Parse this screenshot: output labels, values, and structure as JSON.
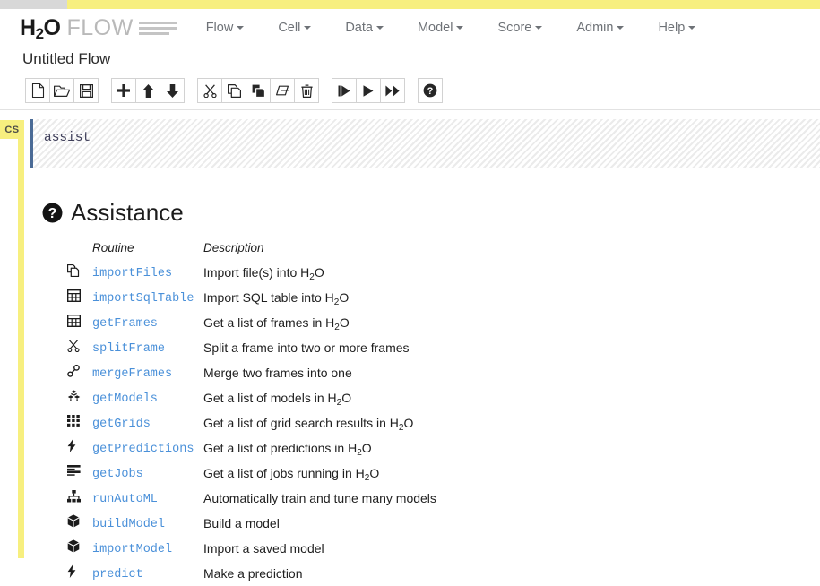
{
  "theme": {
    "accent_yellow": "#f7ef7f",
    "accent_gray": "#d8d8d8",
    "link_blue": "#4a90d9",
    "cell_bar_blue": "#4b6b96",
    "nav_text": "#6e7277"
  },
  "brand": {
    "h2o_main": "H",
    "h2o_sub": "2",
    "h2o_tail": "O",
    "product": "FLOW",
    "menu_icon": "hamburger-icon"
  },
  "nav": {
    "items": [
      {
        "label": "Flow",
        "has_caret": true
      },
      {
        "label": "Cell",
        "has_caret": true
      },
      {
        "label": "Data",
        "has_caret": true
      },
      {
        "label": "Model",
        "has_caret": true
      },
      {
        "label": "Score",
        "has_caret": true
      },
      {
        "label": "Admin",
        "has_caret": true
      },
      {
        "label": "Help",
        "has_caret": true
      }
    ]
  },
  "flow": {
    "title": "Untitled Flow"
  },
  "toolbar": {
    "groups": [
      {
        "buttons": [
          {
            "name": "new-flow-button",
            "icon": "file-icon",
            "title": "New Flow"
          },
          {
            "name": "open-flow-button",
            "icon": "folder-open-icon",
            "title": "Open Flow"
          },
          {
            "name": "save-flow-button",
            "icon": "floppy-save-icon",
            "title": "Save Flow"
          }
        ]
      },
      {
        "buttons": [
          {
            "name": "insert-cell-button",
            "icon": "plus-icon",
            "title": "Insert Cell"
          },
          {
            "name": "move-cell-up-button",
            "icon": "arrow-up-icon",
            "title": "Move Cell Up"
          },
          {
            "name": "move-cell-down-button",
            "icon": "arrow-down-icon",
            "title": "Move Cell Down"
          }
        ]
      },
      {
        "buttons": [
          {
            "name": "cut-cell-button",
            "icon": "scissors-icon",
            "title": "Cut Cell"
          },
          {
            "name": "copy-cell-button",
            "icon": "copy-icon",
            "title": "Copy Cell"
          },
          {
            "name": "paste-cell-button",
            "icon": "paste-icon",
            "title": "Paste Cell"
          },
          {
            "name": "clear-cell-button",
            "icon": "eraser-icon",
            "title": "Clear Cell"
          },
          {
            "name": "delete-cell-button",
            "icon": "trash-icon",
            "title": "Delete Cell"
          }
        ]
      },
      {
        "buttons": [
          {
            "name": "run-cell-button",
            "icon": "step-forward-icon",
            "title": "Run Cell"
          },
          {
            "name": "run-and-select-button",
            "icon": "play-icon",
            "title": "Run and Select Below"
          },
          {
            "name": "run-all-button",
            "icon": "fast-forward-icon",
            "title": "Run All Cells"
          }
        ]
      },
      {
        "buttons": [
          {
            "name": "assist-help-button",
            "icon": "question-circle-icon",
            "title": "Assist Me"
          }
        ]
      }
    ]
  },
  "cell": {
    "badge": "CS",
    "input_value": "assist",
    "input_placeholder": ""
  },
  "assistance": {
    "icon": "question-circle-icon",
    "heading": "Assistance",
    "columns": {
      "routine": "Routine",
      "description": "Description"
    },
    "rows": [
      {
        "icon": "copy-files-icon",
        "routine": "importFiles",
        "desc_pre": "Import file(s) into H",
        "desc_sub": "2",
        "desc_post": "O"
      },
      {
        "icon": "table-grid-icon",
        "routine": "importSqlTable",
        "desc_pre": "Import SQL table into H",
        "desc_sub": "2",
        "desc_post": "O"
      },
      {
        "icon": "table-grid-icon",
        "routine": "getFrames",
        "desc_pre": "Get a list of frames in H",
        "desc_sub": "2",
        "desc_post": "O"
      },
      {
        "icon": "scissors-icon",
        "routine": "splitFrame",
        "desc_pre": "Split a frame into two or more frames",
        "desc_sub": "",
        "desc_post": ""
      },
      {
        "icon": "link-chain-icon",
        "routine": "mergeFrames",
        "desc_pre": "Merge two frames into one",
        "desc_sub": "",
        "desc_post": ""
      },
      {
        "icon": "cubes-icon",
        "routine": "getModels",
        "desc_pre": "Get a list of models in H",
        "desc_sub": "2",
        "desc_post": "O"
      },
      {
        "icon": "grid-dots-icon",
        "routine": "getGrids",
        "desc_pre": "Get a list of grid search results in H",
        "desc_sub": "2",
        "desc_post": "O"
      },
      {
        "icon": "bolt-icon",
        "routine": "getPredictions",
        "desc_pre": "Get a list of predictions in H",
        "desc_sub": "2",
        "desc_post": "O"
      },
      {
        "icon": "tasks-list-icon",
        "routine": "getJobs",
        "desc_pre": "Get a list of jobs running in H",
        "desc_sub": "2",
        "desc_post": "O"
      },
      {
        "icon": "sitemap-icon",
        "routine": "runAutoML",
        "desc_pre": "Automatically train and tune many models",
        "desc_sub": "",
        "desc_post": ""
      },
      {
        "icon": "cube-icon",
        "routine": "buildModel",
        "desc_pre": "Build a model",
        "desc_sub": "",
        "desc_post": ""
      },
      {
        "icon": "cube-icon",
        "routine": "importModel",
        "desc_pre": "Import a saved model",
        "desc_sub": "",
        "desc_post": ""
      },
      {
        "icon": "bolt-icon",
        "routine": "predict",
        "desc_pre": "Make a prediction",
        "desc_sub": "",
        "desc_post": ""
      }
    ]
  }
}
